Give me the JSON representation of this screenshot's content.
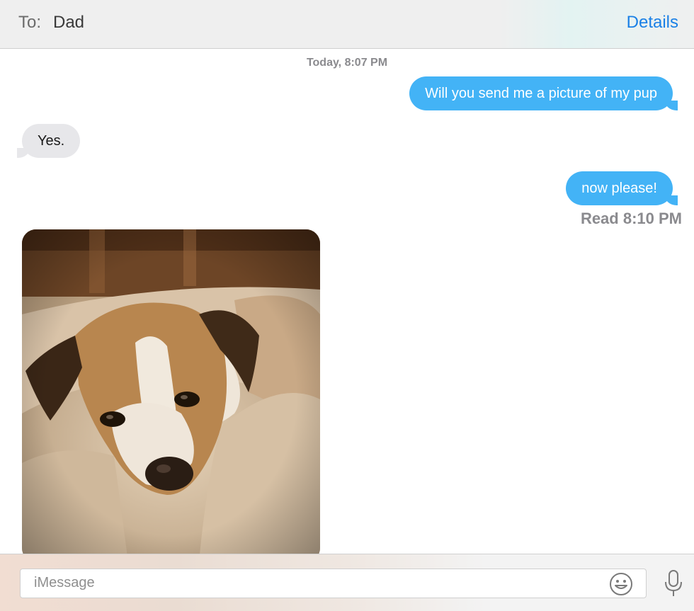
{
  "header": {
    "to_label": "To:",
    "recipient": "Dad",
    "details_label": "Details"
  },
  "conversation": {
    "timestamp": "Today, 8:07 PM",
    "messages": [
      {
        "direction": "sent",
        "text": "Will you send me a picture of my pup"
      },
      {
        "direction": "received",
        "text": "Yes."
      },
      {
        "direction": "sent",
        "text": "now please!"
      },
      {
        "direction": "received",
        "type": "photo"
      }
    ],
    "read_receipt": "Read 8:10 PM"
  },
  "composer": {
    "placeholder": "iMessage",
    "emoji_icon": "emoji-icon",
    "mic_icon": "microphone-icon"
  },
  "colors": {
    "sent_bubble": "#43b3f6",
    "received_bubble": "#e7e7ea",
    "accent": "#1a80e6"
  }
}
